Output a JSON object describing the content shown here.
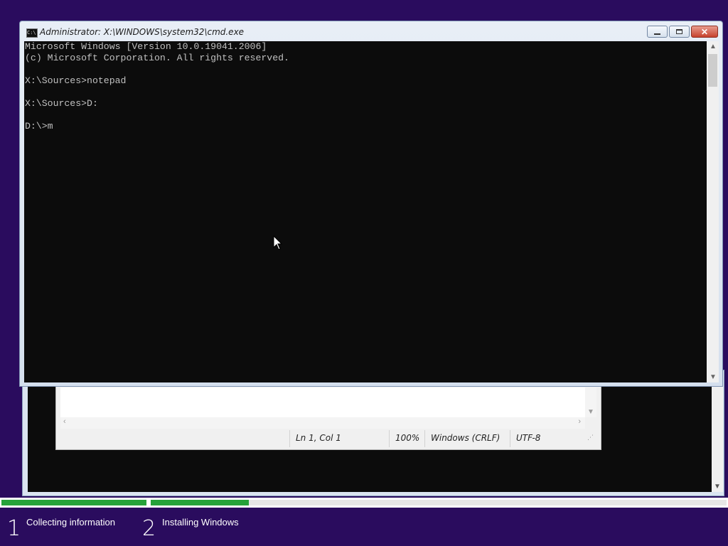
{
  "cmd_window": {
    "title": "Administrator: X:\\WINDOWS\\system32\\cmd.exe",
    "icon_text": "C:\\",
    "console_lines": [
      "Microsoft Windows [Version 10.0.19041.2006]",
      "(c) Microsoft Corporation. All rights reserved.",
      "",
      "X:\\Sources>notepad",
      "",
      "X:\\Sources>D:",
      "",
      "D:\\>m"
    ],
    "close_symbol": "✕"
  },
  "notepad": {
    "status": {
      "position": "Ln 1, Col 1",
      "zoom": "100%",
      "line_ending": "Windows (CRLF)",
      "encoding": "UTF-8"
    }
  },
  "setup": {
    "steps": [
      {
        "number": "1",
        "label": "Collecting information"
      },
      {
        "number": "2",
        "label": "Installing Windows"
      }
    ],
    "progress_step1": 1.0,
    "progress_step2": 0.17,
    "progress_color": "#26a23a"
  },
  "colors": {
    "desktop": "#2a0c5e",
    "console_bg": "#0c0c0c",
    "console_fg": "#c0c0c0"
  },
  "icons": [
    "cmd-icon",
    "minimize-icon",
    "maximize-icon",
    "close-icon",
    "mouse-cursor-icon"
  ]
}
